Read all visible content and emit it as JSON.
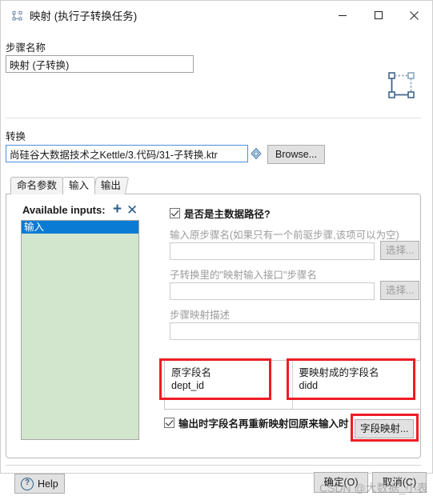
{
  "window": {
    "title": "映射 (执行子转换任务)",
    "icon": "mapping-step-icon",
    "controls": {
      "minimize": "–",
      "maximize": "☐",
      "close": "✕"
    }
  },
  "step": {
    "label": "步骤名称",
    "value": "映射 (子转换)",
    "icon": "mapping-step-icon"
  },
  "transform": {
    "label": "转换",
    "value": "尚硅谷大数据技术之Kettle/3.代码/31-子转换.ktr",
    "picker_icon": "variable-picker-icon",
    "browse_label": "Browse..."
  },
  "tabs": [
    {
      "label": "命名参数",
      "active": false
    },
    {
      "label": "输入",
      "active": true
    },
    {
      "label": "输出",
      "active": false
    }
  ],
  "inputs_panel": {
    "available_label": "Available inputs:",
    "add_icon": "plus-icon",
    "remove_icon": "close-x-icon",
    "items": [
      {
        "label": "输入",
        "selected": true
      }
    ]
  },
  "right_panel": {
    "main_path_checkbox": {
      "label": "是否是主数据路径?",
      "checked": true
    },
    "source_step": {
      "label": "输入原步骤名(如果只有一个前驱步骤,该项可以为空)",
      "value": "",
      "button": "选择...",
      "disabled": true
    },
    "mapping_input_step": {
      "label": "子转换里的\"映射输入接口\"步骤名",
      "value": "",
      "button": "选择...",
      "disabled": true
    },
    "description": {
      "label": "步骤映射描述",
      "value": ""
    },
    "field_table": {
      "columns": [
        "原字段名",
        "要映射成的字段名"
      ],
      "rows": [
        [
          "dept_id",
          "didd"
        ],
        [
          "",
          ""
        ]
      ]
    },
    "rename_checkbox": {
      "label": "输出时字段名再重新映射回原来输入时",
      "checked": true
    },
    "field_mapping_button": "字段映射..."
  },
  "footer": {
    "help": "Help",
    "help_icon": "question-circle-icon",
    "ok": "确定(O)",
    "cancel": "取消(C)"
  },
  "annotations": {
    "highlight_color": "#EE1C25",
    "boxes": [
      "source-field-column",
      "target-field-column",
      "field-mapping-button"
    ]
  },
  "watermark": "CSDN @大数据_小表"
}
